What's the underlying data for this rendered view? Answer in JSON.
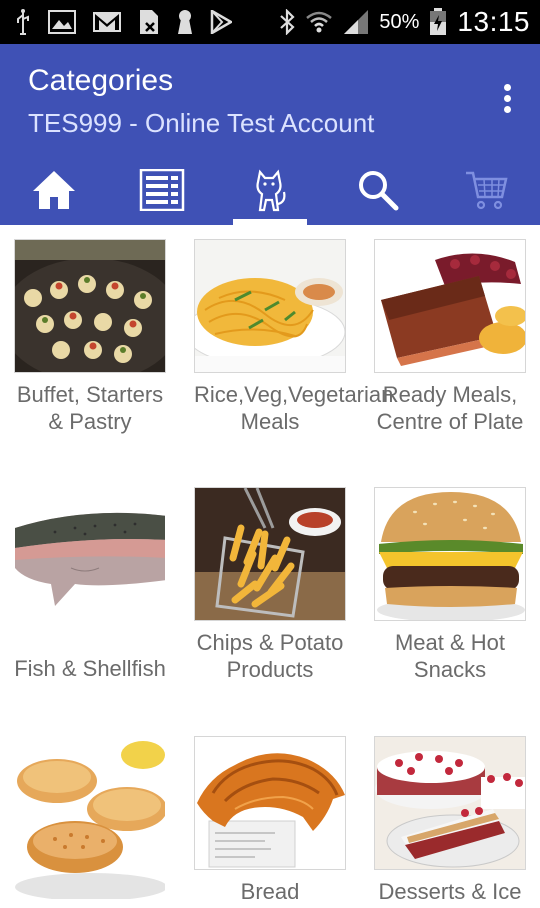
{
  "status_bar": {
    "battery": "50%",
    "time": "13:15",
    "icons": [
      "usb-icon",
      "image-icon",
      "gmail-icon",
      "sim-icon",
      "keyhole-icon",
      "play-store-icon",
      "bluetooth-icon",
      "wifi-icon",
      "signal-icon",
      "battery-icon"
    ]
  },
  "header": {
    "title": "Categories",
    "subtitle": "TES999 - Online Test Account"
  },
  "tabs": [
    {
      "icon": "home-icon"
    },
    {
      "icon": "list-icon"
    },
    {
      "icon": "categories-cat-icon",
      "active": true
    },
    {
      "icon": "search-icon"
    },
    {
      "icon": "cart-icon"
    }
  ],
  "categories": [
    {
      "name": "Buffet, Starters & Pastry"
    },
    {
      "name": "Rice,Veg,Vegetarian Meals"
    },
    {
      "name": "Ready Meals, Centre of Plate"
    },
    {
      "name": "Fish & Shellfish"
    },
    {
      "name": "Chips & Potato Products"
    },
    {
      "name": "Meat & Hot Snacks"
    },
    {
      "name": ""
    },
    {
      "name": "Bread"
    },
    {
      "name": "Desserts & Ice"
    }
  ],
  "colors": {
    "app_bar": "#3f51b5",
    "caption": "#6b6b6b"
  }
}
